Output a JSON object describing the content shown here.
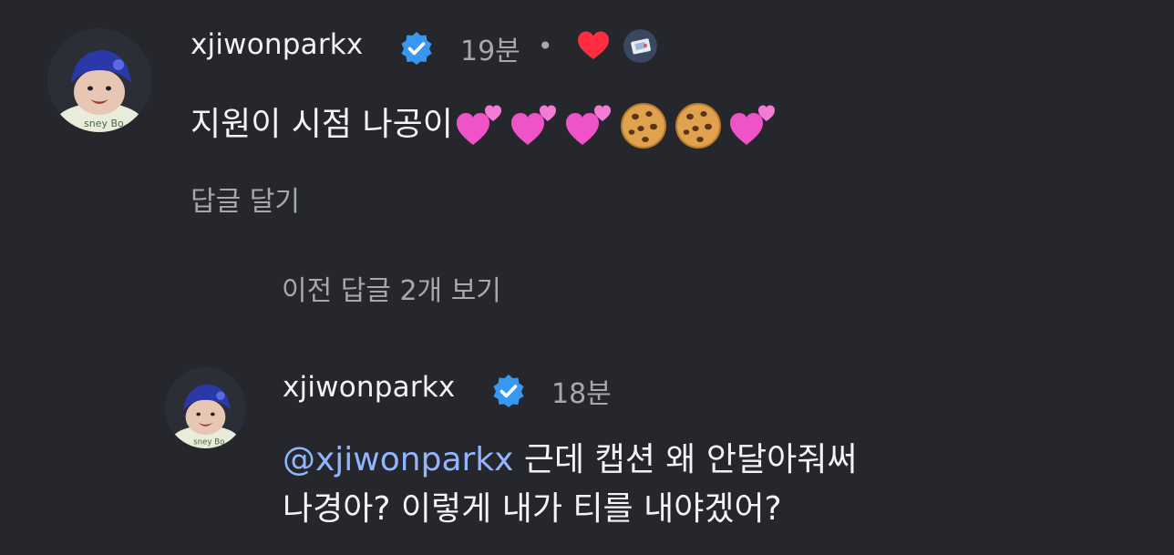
{
  "comment": {
    "username": "xjiwonparkx",
    "time": "19분",
    "separator": "•",
    "text": "지원이 시점 나공이",
    "emojis": [
      "two-hearts-icon",
      "two-hearts-icon",
      "two-hearts-icon",
      "cookie-icon",
      "cookie-icon",
      "two-hearts-icon"
    ],
    "reply_label": "답글 달기",
    "heart_color": "#ff2d3f"
  },
  "view_replies": "이전 답글 2개 보기",
  "reply": {
    "username": "xjiwonparkx",
    "time": "18분",
    "mention": "@xjiwonparkx",
    "line1": "근데 캡션 왜 안달아줘써",
    "line2": "나경아? 이렇게 내가 티를 내야겠어?"
  },
  "colors": {
    "background": "#25272d",
    "verified": "#3897f0",
    "mention": "#8fb6ff",
    "secondary_text": "#a6a8ad"
  }
}
